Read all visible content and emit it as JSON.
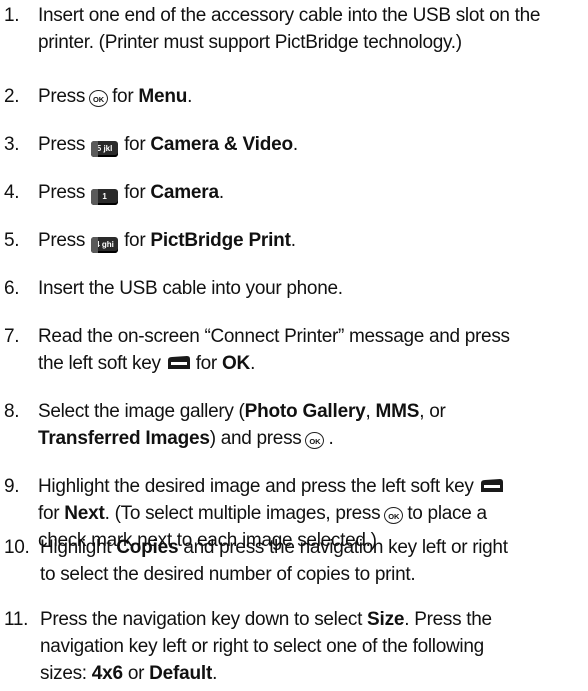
{
  "steps": [
    {
      "num": "1.",
      "parts": [
        "Insert one end of the accessory cable into the USB slot on the printer. (Printer must support PictBridge technology.)"
      ]
    },
    {
      "num": "2.",
      "pre": "Press",
      "post": "for",
      "bold": "Menu",
      "end": "."
    },
    {
      "num": "3.",
      "pre": "Press",
      "key": "5 jkl",
      "post": "for",
      "bold": "Camera & Video",
      "end": "."
    },
    {
      "num": "4.",
      "pre": "Press",
      "key": "1",
      "post": "for",
      "bold": "Camera",
      "end": "."
    },
    {
      "num": "5.",
      "pre": "Press",
      "key": "4 ghi",
      "post": "for",
      "bold": "PictBridge Print",
      "end": "."
    },
    {
      "num": "6.",
      "text": "Insert the USB cable into your phone."
    },
    {
      "num": "7.",
      "line1": "Read the on-screen “Connect Printer” message and press",
      "line2_pre": "the left soft key",
      "line2_post": "for",
      "bold": "OK",
      "end": "."
    },
    {
      "num": "8.",
      "pre": "Select the image gallery (",
      "b1": "Photo Gallery",
      "sep1": ", ",
      "b2": "MMS",
      "sep2": ", or",
      "b3": "Transferred Images",
      "post": ") and press",
      "end": "."
    },
    {
      "num": "9.",
      "line1": "Highlight the desired image and press the left soft key",
      "line2_pre": "for",
      "bold": "Next",
      "line2_mid": ". (To select multiple images, press",
      "line2_post": "to place a",
      "line3": "check mark next to each image selected.)"
    },
    {
      "num": "10.",
      "pre": "Highlight",
      "bold": "Copies",
      "post": "and press the navigation key left or right",
      "line2": "to select the desired number of copies to print."
    },
    {
      "num": "11.",
      "pre": "Press the navigation key down to select",
      "bold": "Size",
      "post": ". Press the",
      "line2": "navigation key left or right to select one of the following",
      "line3_pre": "sizes:",
      "b1": "4x6",
      "mid": "or",
      "b2": "Default",
      "end": "."
    }
  ],
  "icons": {
    "ok_label": "OK",
    "soft_key": "left-soft-key-icon"
  }
}
